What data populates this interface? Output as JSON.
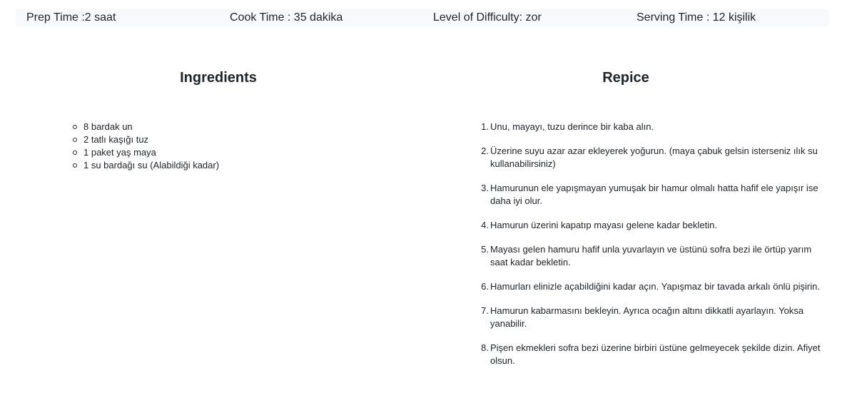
{
  "info": {
    "prep": "Prep Time :2 saat",
    "cook": "Cook Time : 35 dakika",
    "level": "Level of Difficulty: zor",
    "serving": "Serving Time : 12 kişilik"
  },
  "ingredients": {
    "title": "Ingredients",
    "items": [
      "8 bardak un",
      "2 tatlı kaşığı tuz",
      "1 paket yaş maya",
      "1 su bardağı su (Alabildiği kadar)"
    ]
  },
  "recipe": {
    "title": "Repice",
    "steps": [
      {
        "num": "1.",
        "text": "Unu, mayayı, tuzu derince bir kaba alın."
      },
      {
        "num": "2.",
        "text": "Üzerine suyu azar azar ekleyerek yoğurun. (maya çabuk gelsin isterseniz ılık su kullanabilirsiniz)"
      },
      {
        "num": "3.",
        "text": "Hamurunun ele yapışmayan yumuşak bir hamur olmalı hatta hafif ele yapışır ise daha iyi olur."
      },
      {
        "num": "4.",
        "text": "Hamurun üzerini kapatıp mayası gelene kadar bekletin."
      },
      {
        "num": "5.",
        "text": "Mayası gelen hamuru hafif unla yuvarlayın ve üstünü sofra bezi ile örtüp yarım saat kadar bekletin."
      },
      {
        "num": "6.",
        "text": "Hamurları elinizle açabildiğini kadar açın. Yapışmaz bir tavada arkalı önlü pişirin."
      },
      {
        "num": "7.",
        "text": "Hamurun kabarmasını bekleyin. Ayrıca ocağın altını dikkatli ayarlayın. Yoksa yanabilir."
      },
      {
        "num": "8.",
        "text": "Pişen ekmekleri sofra bezi üzerine birbiri üstüne gelmeyecek şekilde dizin. Afiyet olsun."
      }
    ]
  }
}
